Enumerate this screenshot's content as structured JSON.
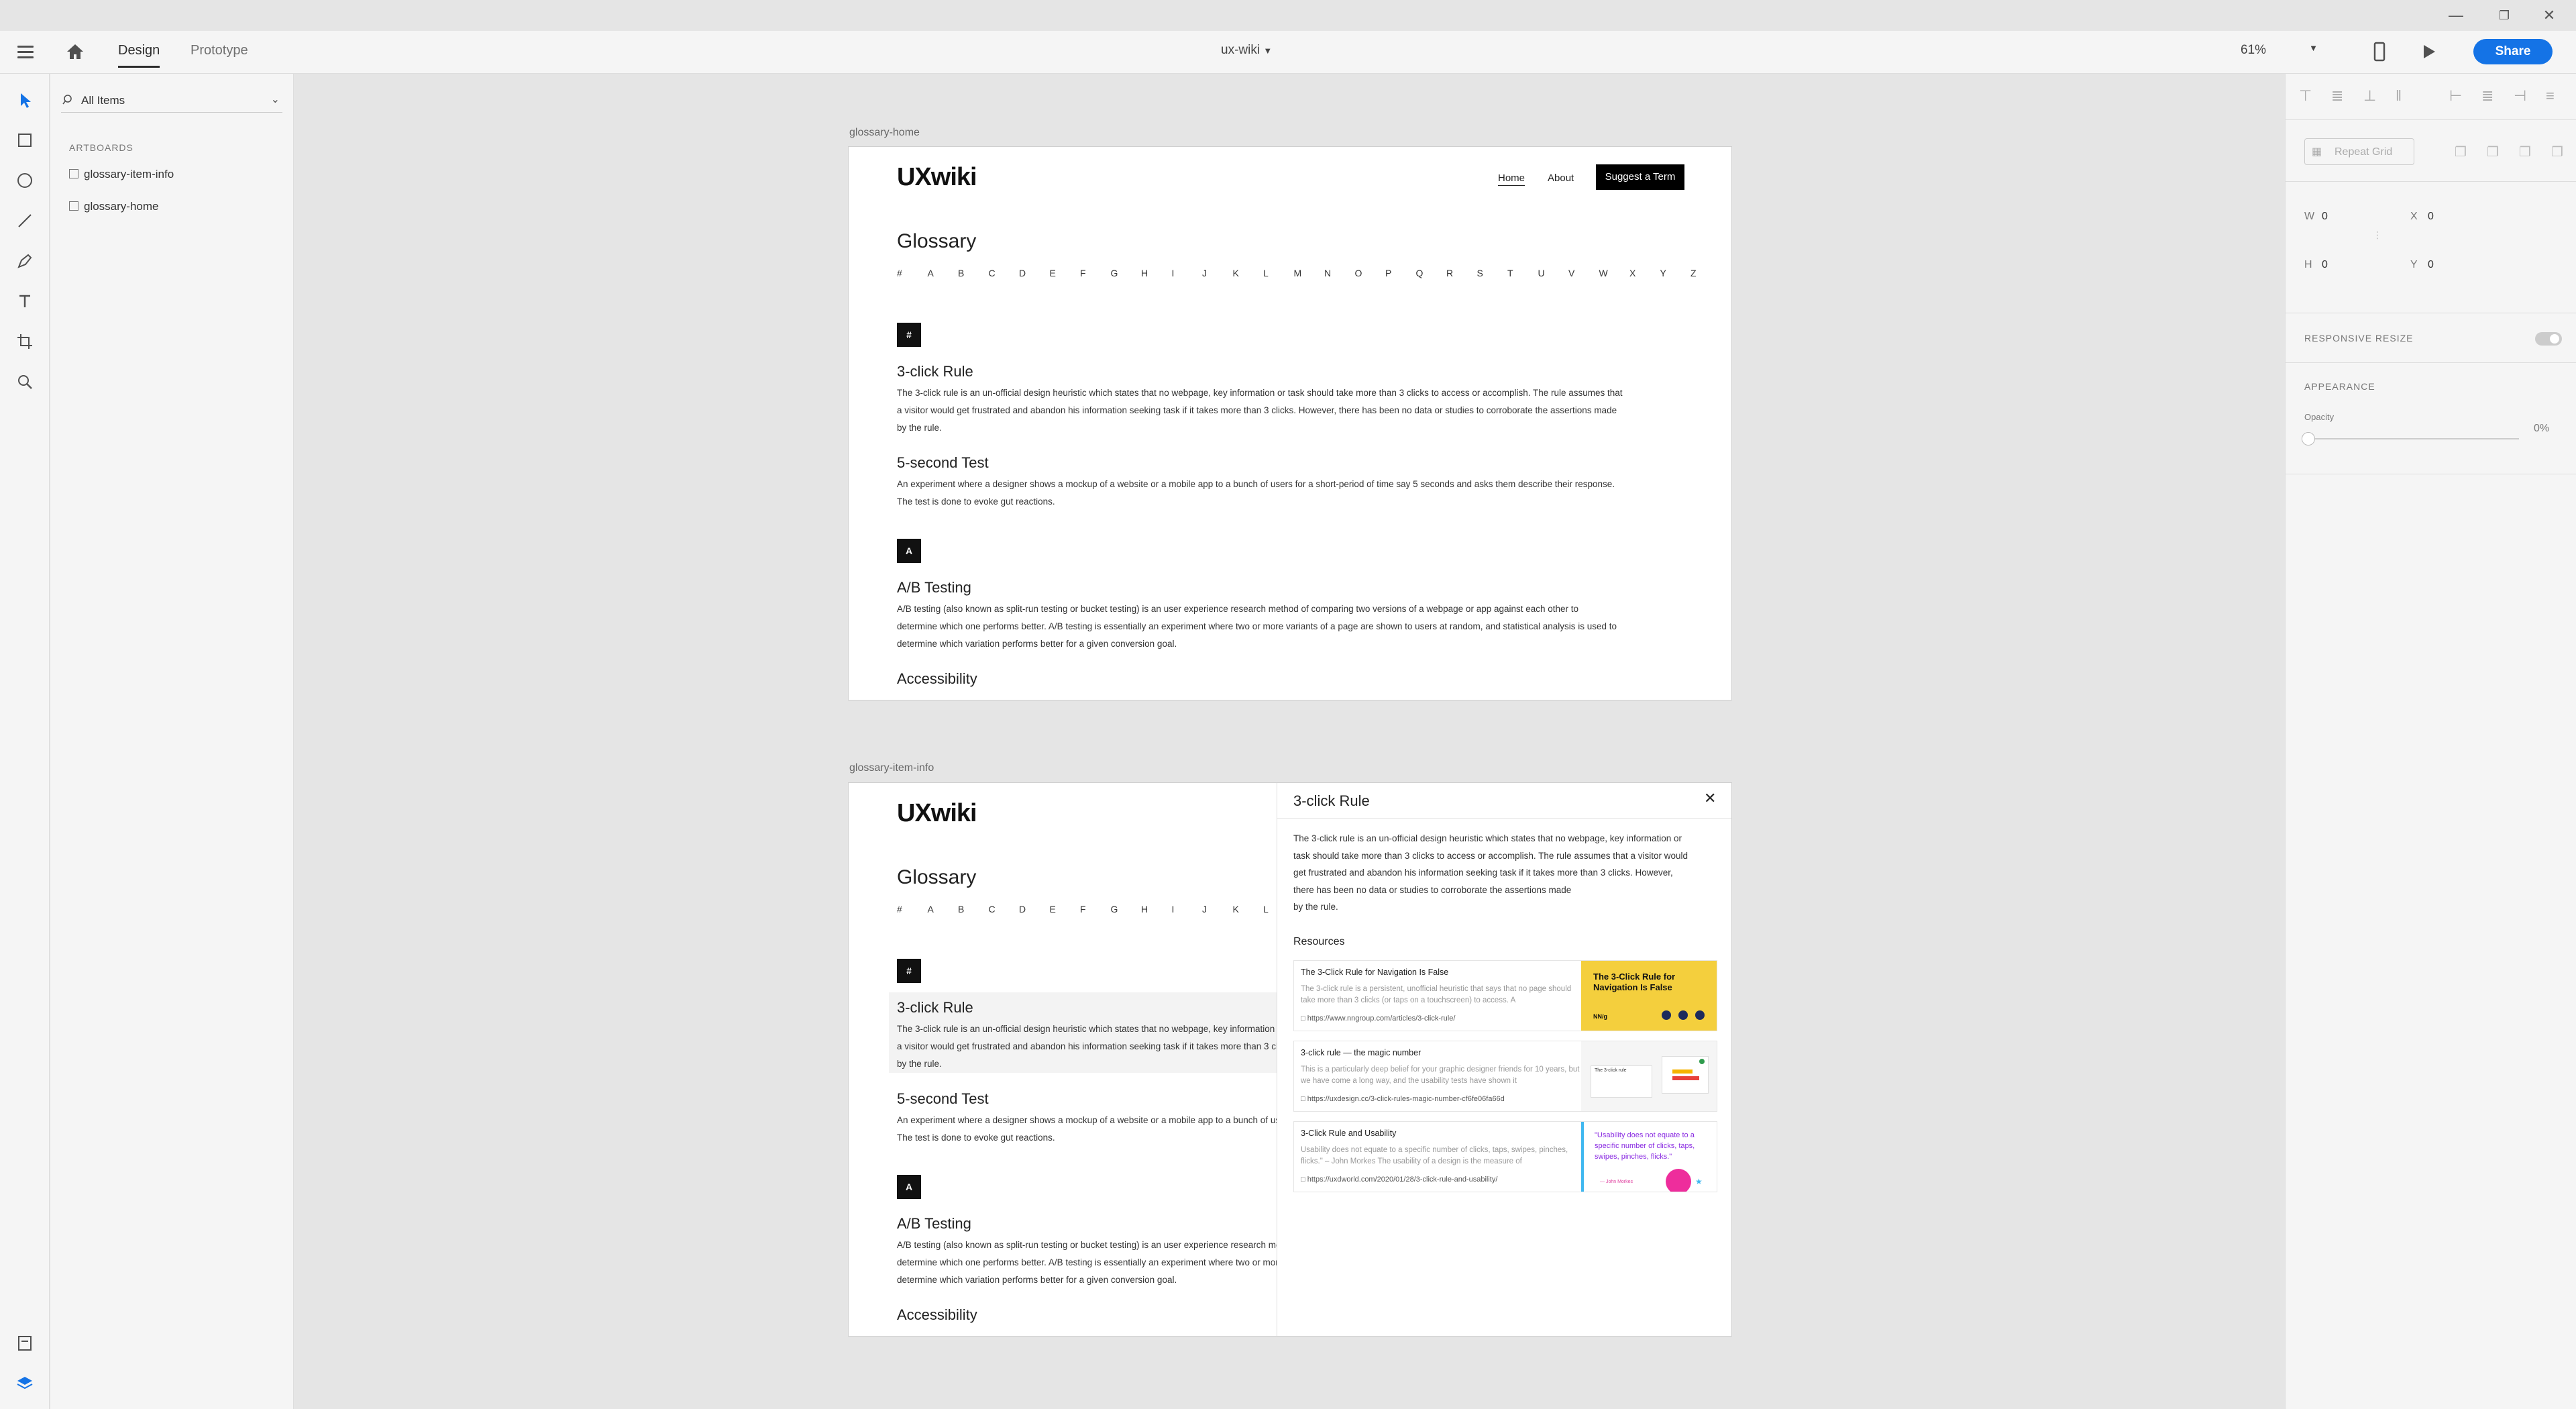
{
  "app": {
    "tabs": [
      "Design",
      "Prototype"
    ],
    "active_tab": "Design",
    "document_title": "ux-wiki",
    "zoom": "61%",
    "share_label": "Share"
  },
  "layers": {
    "filter_label": "All Items",
    "section_label": "ARTBOARDS",
    "items": [
      "glossary-item-info",
      "glossary-home"
    ]
  },
  "inspector": {
    "repeat_grid_label": "Repeat Grid",
    "w_label": "W",
    "w_value": "0",
    "h_label": "H",
    "h_value": "0",
    "x_label": "X",
    "x_value": "0",
    "y_label": "Y",
    "y_value": "0",
    "responsive_label": "RESPONSIVE RESIZE",
    "appearance_label": "APPEARANCE",
    "opacity_label": "Opacity",
    "opacity_value": "0%"
  },
  "site": {
    "logo": "UXwiki",
    "nav": [
      "Home",
      "About"
    ],
    "cta": "Suggest a Term",
    "glossary_title": "Glossary",
    "alphabet": [
      "#",
      "A",
      "B",
      "C",
      "D",
      "E",
      "F",
      "G",
      "H",
      "I",
      "J",
      "K",
      "L",
      "M",
      "N",
      "O",
      "P",
      "Q",
      "R",
      "S",
      "T",
      "U",
      "V",
      "W",
      "X",
      "Y",
      "Z"
    ],
    "sections": [
      {
        "letter": "#",
        "terms": [
          {
            "title": "3-click Rule",
            "definition_lines": [
              "The 3-click rule is an un-official design heuristic which states that no webpage, key information or task should take more than 3 clicks to access or accomplish. The rule assumes that",
              "a visitor would get frustrated and abandon his information seeking task if it takes more than 3 clicks. However, there has been no data or studies to corroborate the assertions made",
              "by the rule."
            ]
          },
          {
            "title": "5-second Test",
            "definition_lines": [
              "An experiment where a designer shows a mockup of a website or a mobile app to a bunch of users for a short-period of time say 5 seconds and asks them describe their response.",
              "The test is done to evoke gut reactions."
            ]
          }
        ]
      },
      {
        "letter": "A",
        "terms": [
          {
            "title": "A/B Testing",
            "definition_lines": [
              "A/B testing (also known as split-run testing or bucket testing) is an user experience research method of comparing two versions of a webpage or app against each other to",
              "determine which one performs better. A/B testing is essentially an experiment where two or more variants of a page are shown to users at random, and statistical analysis is used to",
              "determine which variation performs better for a given conversion goal."
            ]
          },
          {
            "title": "Accessibility",
            "definition_lines": []
          }
        ]
      }
    ]
  },
  "artboards": {
    "home_label": "glossary-home",
    "info_label": "glossary-item-info"
  },
  "detail": {
    "title": "3-click Rule",
    "definition_lines": [
      "The 3-click rule is an un-official design heuristic which states that no webpage, key information or",
      "task should take more than 3 clicks to access or accomplish. The rule assumes that a visitor would",
      "get frustrated and abandon his information seeking task if it takes more than 3 clicks. However,",
      "there has been no data or studies to corroborate the assertions made",
      "by the rule."
    ],
    "resources_label": "Resources",
    "resources": [
      {
        "title": "The 3-Click Rule for Navigation Is False",
        "desc": "The 3-click rule is a persistent, unofficial heuristic that says that no page should take more than 3 clicks (or taps on a touchscreen) to access. A",
        "url": "https://www.nngroup.com/articles/3-click-rule/",
        "thumb_text": "The 3-Click Rule for Navigation Is False",
        "thumb_small": "NN/g"
      },
      {
        "title": "3-click rule — the magic number",
        "desc": "This is a particularly deep belief for your graphic designer friends for 10 years, but we have come a long way, and the usability tests have shown it",
        "url": "https://uxdesign.cc/3-click-rules-magic-number-cf6fe06fa66d",
        "thumb_text": "The 3-click rule",
        "thumb_small": ""
      },
      {
        "title": "3-Click Rule and Usability",
        "desc": "Usability does not equate to a specific number of clicks, taps, swipes, pinches, flicks.\" – John Morkes The usability of a design is the measure of",
        "url": "https://uxdworld.com/2020/01/28/3-click-rule-and-usability/",
        "thumb_text": "\"Usability does not equate to a specific number of clicks, taps, swipes, pinches, flicks.\"",
        "thumb_small": "— John Morkes"
      }
    ]
  }
}
